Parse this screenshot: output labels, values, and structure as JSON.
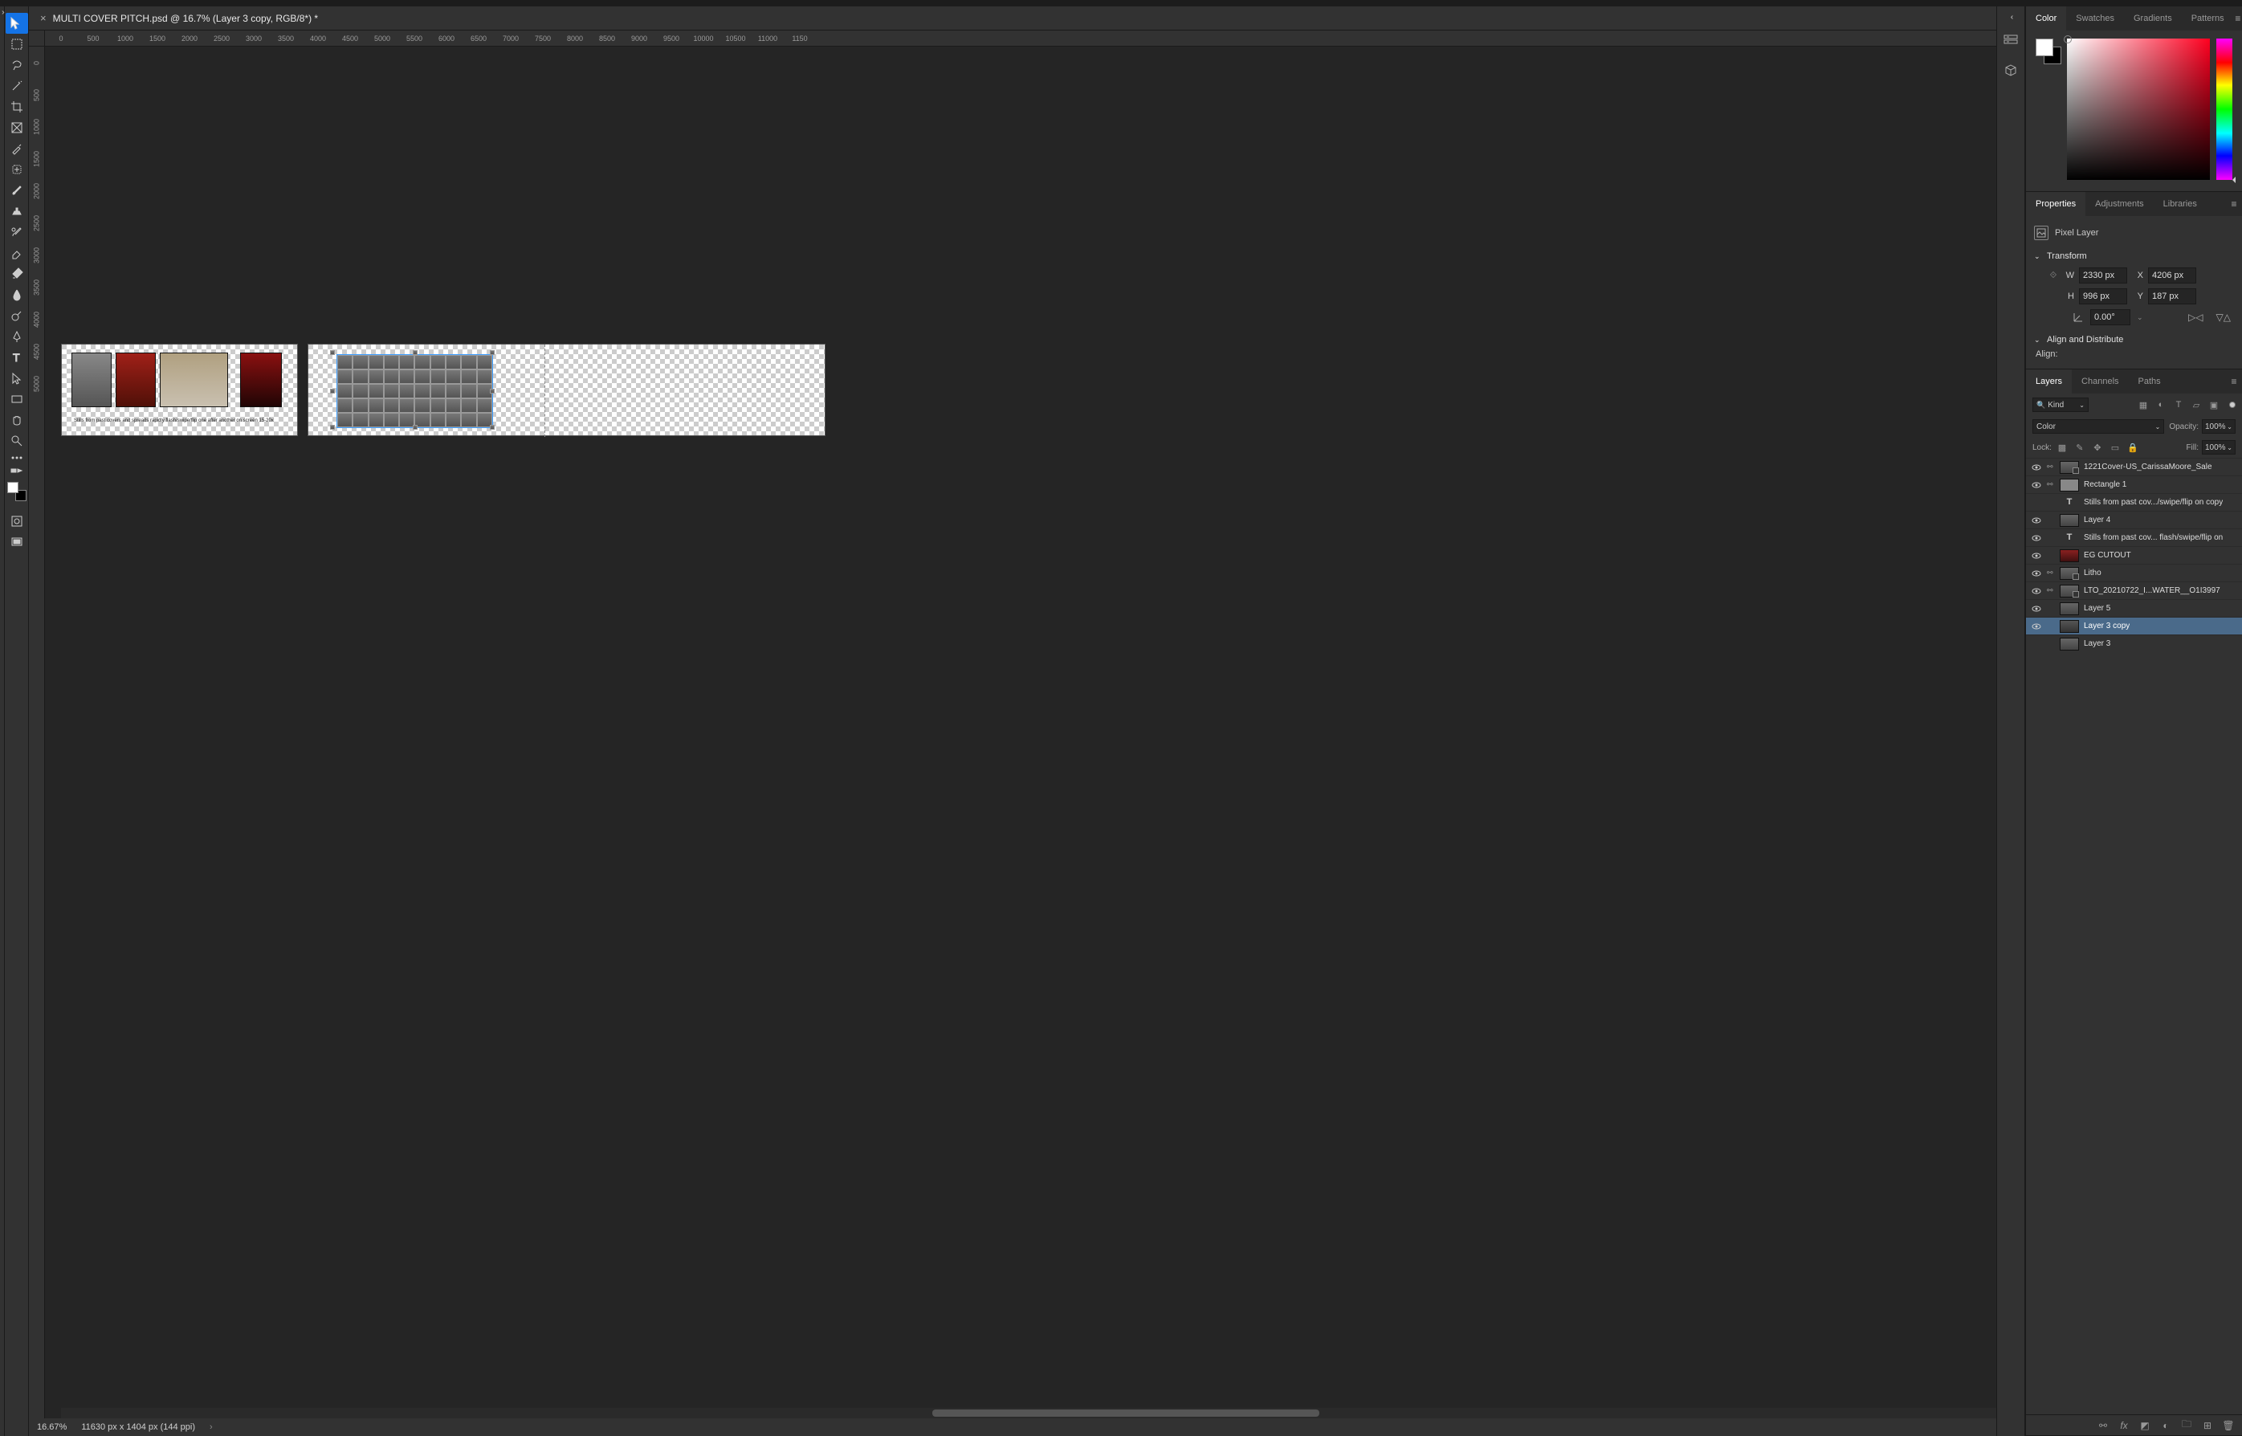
{
  "document": {
    "tab_title": "MULTI COVER PITCH.psd @ 16.7% (Layer 3 copy, RGB/8*) *",
    "zoom": "16.67%",
    "dimensions": "11630 px x 1404 px (144 ppi)"
  },
  "ruler_h": [
    "0",
    "500",
    "1000",
    "1500",
    "2000",
    "2500",
    "3000",
    "3500",
    "4000",
    "4500",
    "5000",
    "5500",
    "6000",
    "6500",
    "7000",
    "7500",
    "8000",
    "8500",
    "9000",
    "9500",
    "10000",
    "10500",
    "11000",
    "1150"
  ],
  "ruler_v": [
    "0",
    "500",
    "1000",
    "1500",
    "2000",
    "2500",
    "3000",
    "3500",
    "4000",
    "4500",
    "5000"
  ],
  "canvas": {
    "caption": "Stills from past covers and spreads rapidly flash/swipe/flip one after another on screen 15-20x"
  },
  "toolbox": {
    "fg": "#ffffff",
    "bg": "#000000"
  },
  "color_panel": {
    "tabs": [
      "Color",
      "Swatches",
      "Gradients",
      "Patterns"
    ],
    "active_tab": 0,
    "fg": "#ffffff",
    "bg": "#000000"
  },
  "properties_panel": {
    "tabs": [
      "Properties",
      "Adjustments",
      "Libraries"
    ],
    "active_tab": 0,
    "layer_type": "Pixel Layer",
    "transform_label": "Transform",
    "W": "2330 px",
    "H": "996 px",
    "X": "4206 px",
    "Y": "187 px",
    "angle": "0.00°",
    "align_distribute_label": "Align and Distribute",
    "align_label": "Align:"
  },
  "layers_panel": {
    "tabs": [
      "Layers",
      "Channels",
      "Paths"
    ],
    "active_tab": 0,
    "kind_label": "Kind",
    "blend_mode": "Color",
    "opacity_label": "Opacity:",
    "opacity_value": "100%",
    "lock_label": "Lock:",
    "fill_label": "Fill:",
    "fill_value": "100%",
    "layers": [
      {
        "visible": true,
        "linked": true,
        "thumb": "smart",
        "name": "1221Cover-US_CarissaMoore_Sale"
      },
      {
        "visible": true,
        "linked": true,
        "thumb": "shape",
        "name": "Rectangle 1"
      },
      {
        "visible": false,
        "linked": false,
        "thumb": "txt",
        "name": "Stills from past cov.../swipe/flip on copy"
      },
      {
        "visible": true,
        "linked": false,
        "thumb": "raster",
        "name": "Layer 4"
      },
      {
        "visible": true,
        "linked": false,
        "thumb": "txt",
        "name": "Stills from past cov... flash/swipe/flip on"
      },
      {
        "visible": true,
        "linked": false,
        "thumb": "raster_red",
        "name": "EG CUTOUT"
      },
      {
        "visible": true,
        "linked": true,
        "thumb": "smart",
        "name": "Litho"
      },
      {
        "visible": true,
        "linked": true,
        "thumb": "smart",
        "name": "LTO_20210722_I...WATER__O1I3997"
      },
      {
        "visible": true,
        "linked": false,
        "thumb": "raster",
        "name": "Layer 5"
      },
      {
        "visible": true,
        "linked": false,
        "thumb": "raster_sel",
        "name": "Layer 3 copy",
        "selected": true
      },
      {
        "visible": false,
        "linked": false,
        "thumb": "raster",
        "name": "Layer 3"
      }
    ]
  }
}
